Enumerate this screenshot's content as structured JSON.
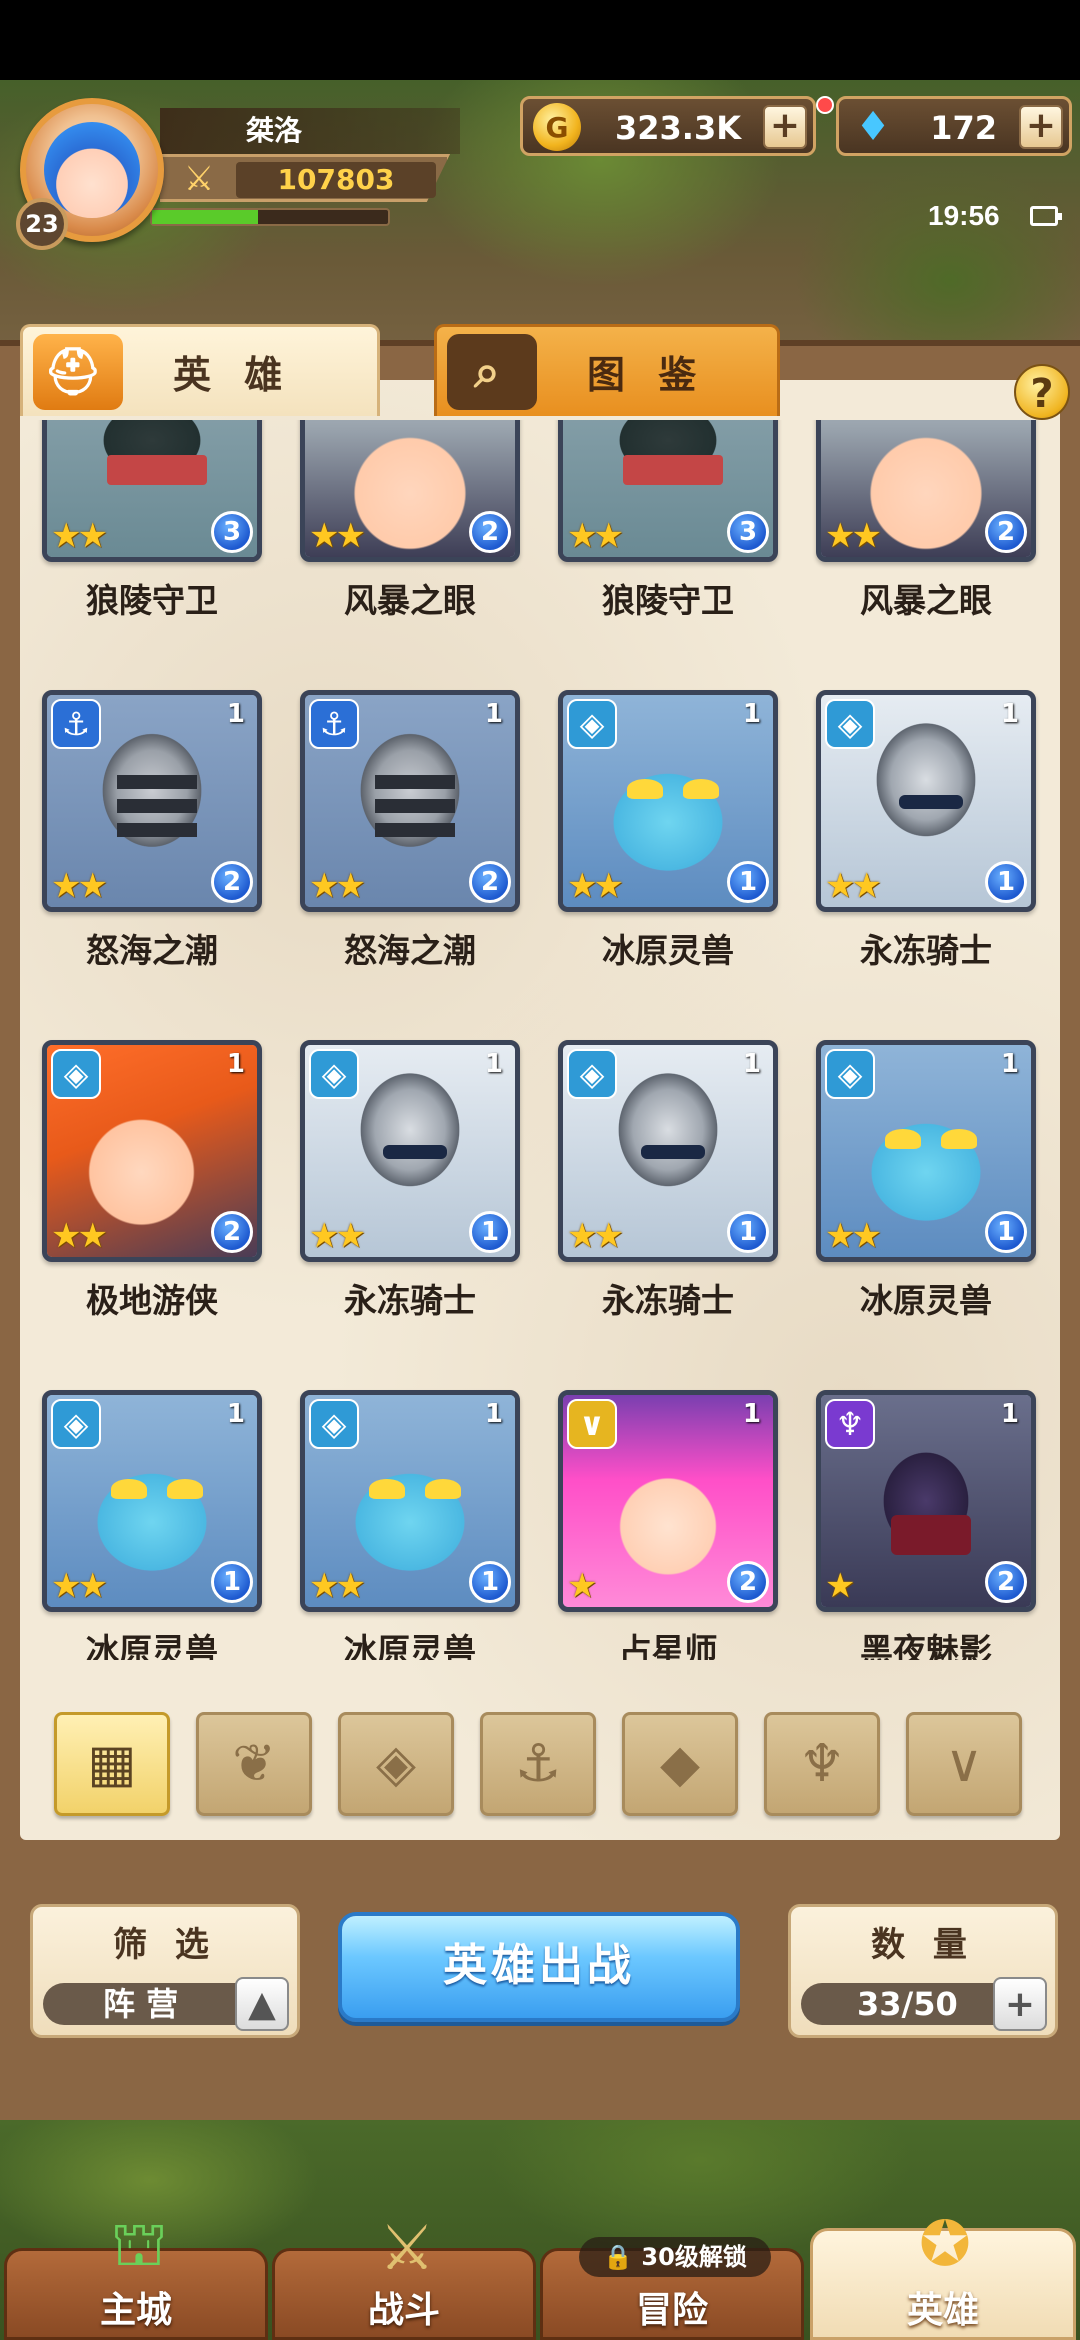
{
  "player": {
    "name": "桀洛",
    "level": "23",
    "power": "107803",
    "exp_fraction": 0.45
  },
  "currency": {
    "gold": "323.3K",
    "gems": "172",
    "plus": "+"
  },
  "status": {
    "time": "19:56"
  },
  "tabs": [
    {
      "label": "英 雄",
      "icon": "knight-helmet-icon",
      "active": true
    },
    {
      "label": "图 鉴",
      "icon": "magnifier-icon",
      "active": false
    }
  ],
  "help": "?",
  "heroes": [
    {
      "name": "狼陵守卫",
      "stars": "★★",
      "level": "3",
      "count": "",
      "faction": "",
      "portrait": "wolf"
    },
    {
      "name": "风暴之眼",
      "stars": "★★",
      "level": "2",
      "count": "",
      "faction": "",
      "portrait": "storm"
    },
    {
      "name": "狼陵守卫",
      "stars": "★★",
      "level": "3",
      "count": "",
      "faction": "",
      "portrait": "wolf"
    },
    {
      "name": "风暴之眼",
      "stars": "★★",
      "level": "2",
      "count": "",
      "faction": "",
      "portrait": "storm"
    },
    {
      "name": "怒海之潮",
      "stars": "★★",
      "level": "2",
      "count": "1",
      "faction": "sea",
      "portrait": "knight"
    },
    {
      "name": "怒海之潮",
      "stars": "★★",
      "level": "2",
      "count": "1",
      "faction": "sea",
      "portrait": "knight"
    },
    {
      "name": "冰原灵兽",
      "stars": "★★",
      "level": "1",
      "count": "1",
      "faction": "ice",
      "portrait": "beast"
    },
    {
      "name": "永冻骑士",
      "stars": "★★",
      "level": "1",
      "count": "1",
      "faction": "ice",
      "portrait": "frost"
    },
    {
      "name": "极地游侠",
      "stars": "★★",
      "level": "2",
      "count": "1",
      "faction": "ice",
      "portrait": "ranger"
    },
    {
      "name": "永冻骑士",
      "stars": "★★",
      "level": "1",
      "count": "1",
      "faction": "ice",
      "portrait": "frost"
    },
    {
      "name": "永冻骑士",
      "stars": "★★",
      "level": "1",
      "count": "1",
      "faction": "ice",
      "portrait": "frost"
    },
    {
      "name": "冰原灵兽",
      "stars": "★★",
      "level": "1",
      "count": "1",
      "faction": "ice",
      "portrait": "beast"
    },
    {
      "name": "冰原灵兽",
      "stars": "★★",
      "level": "1",
      "count": "1",
      "faction": "ice",
      "portrait": "beast"
    },
    {
      "name": "冰原灵兽",
      "stars": "★★",
      "level": "1",
      "count": "1",
      "faction": "ice",
      "portrait": "beast"
    },
    {
      "name": "占星师",
      "stars": "★",
      "level": "2",
      "count": "1",
      "faction": "light",
      "portrait": "astro"
    },
    {
      "name": "黑夜魅影",
      "stars": "★",
      "level": "2",
      "count": "1",
      "faction": "dark",
      "portrait": "shadow"
    }
  ],
  "filters": [
    {
      "icon": "all-grid-icon",
      "active": true
    },
    {
      "icon": "nature-leaf-icon",
      "active": false
    },
    {
      "icon": "ice-faction-icon",
      "active": false
    },
    {
      "icon": "anchor-faction-icon",
      "active": false
    },
    {
      "icon": "beast-head-icon",
      "active": false
    },
    {
      "icon": "dark-horns-icon",
      "active": false
    },
    {
      "icon": "light-v-icon",
      "active": false
    }
  ],
  "filter_box": {
    "title": "筛 选",
    "value": "阵 营"
  },
  "deploy_label": "英雄出战",
  "quantity_box": {
    "title": "数 量",
    "value": "33/50"
  },
  "nav": [
    {
      "label": "主城",
      "icon": "castle-icon",
      "active": false
    },
    {
      "label": "战斗",
      "icon": "crossed-swords-icon",
      "active": false
    },
    {
      "label": "冒险",
      "icon": "adventure-icon",
      "active": false,
      "lock": "30级解锁"
    },
    {
      "label": "英雄",
      "icon": "hero-crest-icon",
      "active": true
    }
  ]
}
